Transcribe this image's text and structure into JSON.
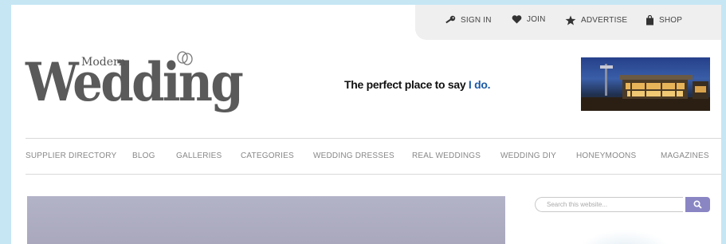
{
  "topbar": {
    "sign_in": "SIGN IN",
    "join": "JOIN",
    "advertise": "ADVERTISE",
    "shop": "SHOP"
  },
  "logo": {
    "small": "Modern",
    "main": "Wedding"
  },
  "tagline": {
    "prefix": "The perfect place to say ",
    "accent": "I do."
  },
  "nav": {
    "items": [
      "SUPPLIER DIRECTORY",
      "BLOG",
      "GALLERIES",
      "CATEGORIES",
      "WEDDING DRESSES",
      "REAL WEDDINGS",
      "WEDDING DIY",
      "HONEYMOONS",
      "MAGAZINES"
    ]
  },
  "search": {
    "placeholder": "Search this website..."
  },
  "colors": {
    "page_background": "#c6e6f4",
    "accent": "#1b5aa8",
    "search_button": "#8a86c4"
  }
}
